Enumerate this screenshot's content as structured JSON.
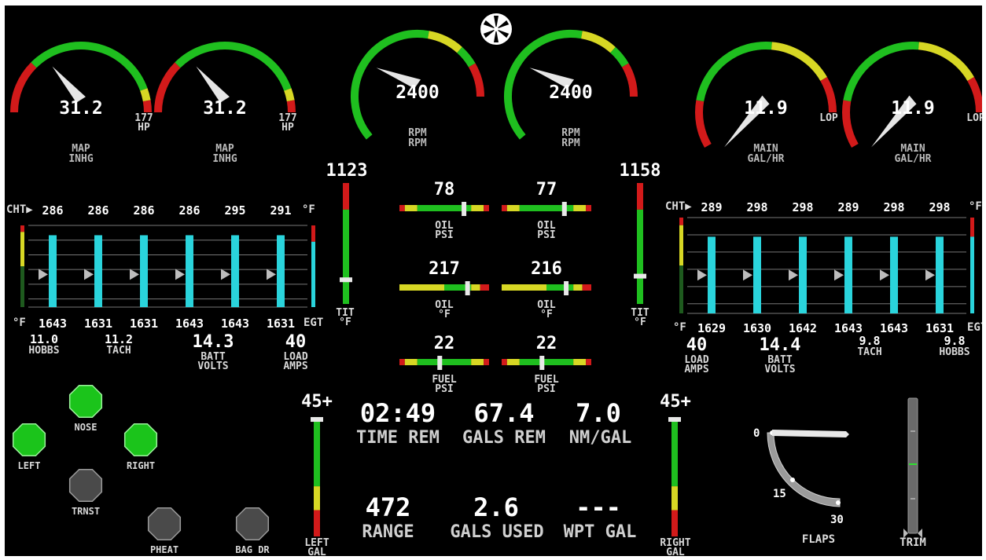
{
  "fan_icon": "fan-icon",
  "colors": {
    "green": "#1fbf1f",
    "yellow": "#d7d724",
    "red": "#d21a1a",
    "cyan": "#2ad4dc",
    "lamp_on": "#1bc41b",
    "lamp_off": "#4a4a4a"
  },
  "gauges": [
    {
      "value": "31.2",
      "sub": "177",
      "sub2": "HP",
      "label1": "MAP",
      "label2": "INHG"
    },
    {
      "value": "31.2",
      "sub": "177",
      "sub2": "HP",
      "label1": "MAP",
      "label2": "INHG"
    },
    {
      "value": "2400",
      "sub": "",
      "sub2": "",
      "label1": "RPM",
      "label2": "RPM"
    },
    {
      "value": "2400",
      "sub": "",
      "sub2": "",
      "label1": "RPM",
      "label2": "RPM"
    },
    {
      "value": "11.9",
      "sub": "LOP",
      "sub2": "",
      "label1": "MAIN",
      "label2": "GAL/HR"
    },
    {
      "value": "11.9",
      "sub": "LOP",
      "sub2": "",
      "label1": "MAIN",
      "label2": "GAL/HR"
    }
  ],
  "left_engine": {
    "cht_label": "CHT▶",
    "unit_top": "°F",
    "unit_bottom_left": "°F",
    "egt_label": "EGT",
    "cht": [
      "286",
      "286",
      "286",
      "286",
      "295",
      "291"
    ],
    "egt": [
      "1643",
      "1631",
      "1631",
      "1643",
      "1643",
      "1631"
    ],
    "hobbs": {
      "value": "11.0",
      "label": "HOBBS"
    },
    "tach": {
      "value": "11.2",
      "label": "TACH"
    },
    "batt": {
      "value": "14.3",
      "label1": "BATT",
      "label2": "VOLTS"
    },
    "load": {
      "value": "40",
      "label1": "LOAD",
      "label2": "AMPS"
    },
    "tit": {
      "value": "1123",
      "label1": "TIT",
      "label2": "°F"
    }
  },
  "right_engine": {
    "cht_label": "CHT▶",
    "unit_top": "°F",
    "unit_bottom_left": "°F",
    "egt_label": "EGT",
    "cht": [
      "289",
      "298",
      "298",
      "289",
      "298",
      "298"
    ],
    "egt": [
      "1629",
      "1630",
      "1642",
      "1643",
      "1643",
      "1631"
    ],
    "hobbs": {
      "value": "9.8",
      "label": "HOBBS"
    },
    "tach": {
      "value": "9.8",
      "label": "TACH"
    },
    "batt": {
      "value": "14.4",
      "label1": "BATT",
      "label2": "VOLTS"
    },
    "load": {
      "value": "40",
      "label1": "LOAD",
      "label2": "AMPS"
    },
    "tit": {
      "value": "1158",
      "label1": "TIT",
      "label2": "°F"
    }
  },
  "center_bars": [
    {
      "value": "78",
      "label1": "OIL",
      "label2": "PSI"
    },
    {
      "value": "77",
      "label1": "OIL",
      "label2": "PSI"
    },
    {
      "value": "217",
      "label1": "OIL",
      "label2": "°F"
    },
    {
      "value": "216",
      "label1": "OIL",
      "label2": "°F"
    },
    {
      "value": "22",
      "label1": "FUEL",
      "label2": "PSI"
    },
    {
      "value": "22",
      "label1": "FUEL",
      "label2": "PSI"
    }
  ],
  "fuel": {
    "left": {
      "top": "45+",
      "label1": "LEFT",
      "label2": "GAL"
    },
    "right": {
      "top": "45+",
      "label1": "RIGHT",
      "label2": "GAL"
    },
    "time_rem": {
      "value": "02:49",
      "label": "TIME REM"
    },
    "gals_rem": {
      "value": "67.4",
      "label": "GALS REM"
    },
    "nm_gal": {
      "value": "7.0",
      "label": "NM/GAL"
    },
    "range": {
      "value": "472",
      "label": "RANGE"
    },
    "gals_used": {
      "value": "2.6",
      "label": "GALS USED"
    },
    "wpt_gal": {
      "value": "---",
      "label": "WPT GAL"
    }
  },
  "lamps": [
    {
      "name": "NOSE",
      "state": "on"
    },
    {
      "name": "LEFT",
      "state": "on"
    },
    {
      "name": "RIGHT",
      "state": "on"
    },
    {
      "name": "TRNST",
      "state": "off"
    },
    {
      "name": "PHEAT",
      "state": "off"
    },
    {
      "name": "BAG DR",
      "state": "off"
    }
  ],
  "flaps": {
    "label": "FLAPS",
    "marks": [
      "0",
      "15",
      "30"
    ],
    "position": 0
  },
  "trim": {
    "label": "TRIM"
  }
}
